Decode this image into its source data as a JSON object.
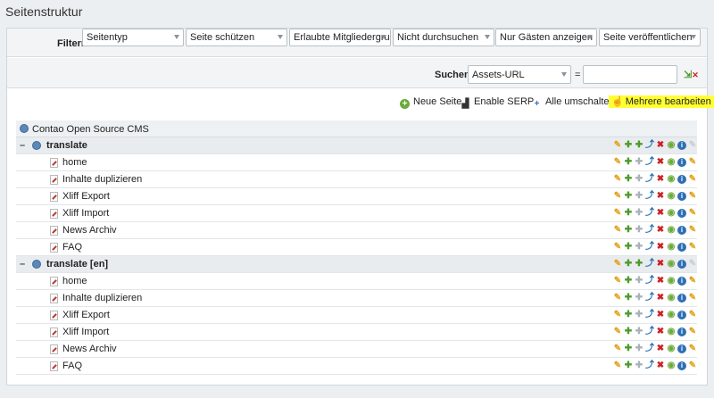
{
  "page": {
    "title": "Seitenstruktur"
  },
  "filters": {
    "label": "Filtern:",
    "selects": [
      "Seitentyp",
      "Seite schützen",
      "Erlaubte Mitgliedergrup",
      "Nicht durchsuchen",
      "Nur Gästen anzeigen",
      "Seite veröffentlichen"
    ]
  },
  "search": {
    "label": "Suchen:",
    "field": "Assets-URL",
    "operator": "=",
    "value": ""
  },
  "global_operations": {
    "new_page": "Neue Seite",
    "enable_serp": "Enable SERP",
    "toggle_all": "Alle umschalten",
    "edit_multiple": "Mehrere bearbeiten"
  },
  "tree": {
    "root": "Contao Open Source CMS",
    "groups": [
      {
        "name": "translate",
        "toggle": "–",
        "pages": [
          "home",
          "Inhalte duplizieren",
          "Xliff Export",
          "Xliff Import",
          "News Archiv",
          "FAQ"
        ]
      },
      {
        "name": "translate [en]",
        "toggle": "–",
        "pages": [
          "home",
          "Inhalte duplizieren",
          "Xliff Export",
          "Xliff Import",
          "News Archiv",
          "FAQ"
        ]
      }
    ]
  },
  "icons": {
    "edit": "pencil-icon",
    "new": "plus-icon",
    "paste": "paste-icon",
    "copy": "copy-icon",
    "delete": "delete-icon",
    "toggle_visibility": "eye-icon",
    "info": "info-icon",
    "header_edit": "header-edit-icon"
  },
  "colors": {
    "highlight": "#ffff33",
    "accent_green": "#4d9b2a",
    "accent_blue": "#2f6fb5",
    "delete_red": "#cc2222"
  }
}
